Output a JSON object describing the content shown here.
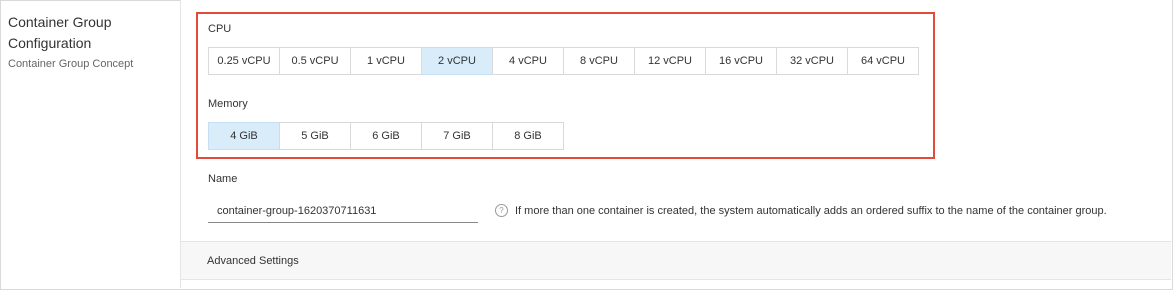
{
  "section": {
    "title": "Container Group Configuration",
    "link": "Container Group Concept"
  },
  "cpu": {
    "label": "CPU",
    "options": [
      "0.25 vCPU",
      "0.5 vCPU",
      "1 vCPU",
      "2 vCPU",
      "4 vCPU",
      "8 vCPU",
      "12 vCPU",
      "16 vCPU",
      "32 vCPU",
      "64 vCPU"
    ],
    "selected": "2 vCPU"
  },
  "memory": {
    "label": "Memory",
    "options": [
      "4 GiB",
      "5 GiB",
      "6 GiB",
      "7 GiB",
      "8 GiB"
    ],
    "selected": "4 GiB"
  },
  "name_field": {
    "label": "Name",
    "value": "container-group-1620370711631",
    "help_icon": "question-circle-icon",
    "help_text": "If more than one container is created, the system automatically adds an ordered suffix to the name of the container group."
  },
  "advanced": {
    "label": "Advanced Settings"
  },
  "colors": {
    "highlight_border": "#e44a3a",
    "selected_bg": "#d9ecfa"
  }
}
